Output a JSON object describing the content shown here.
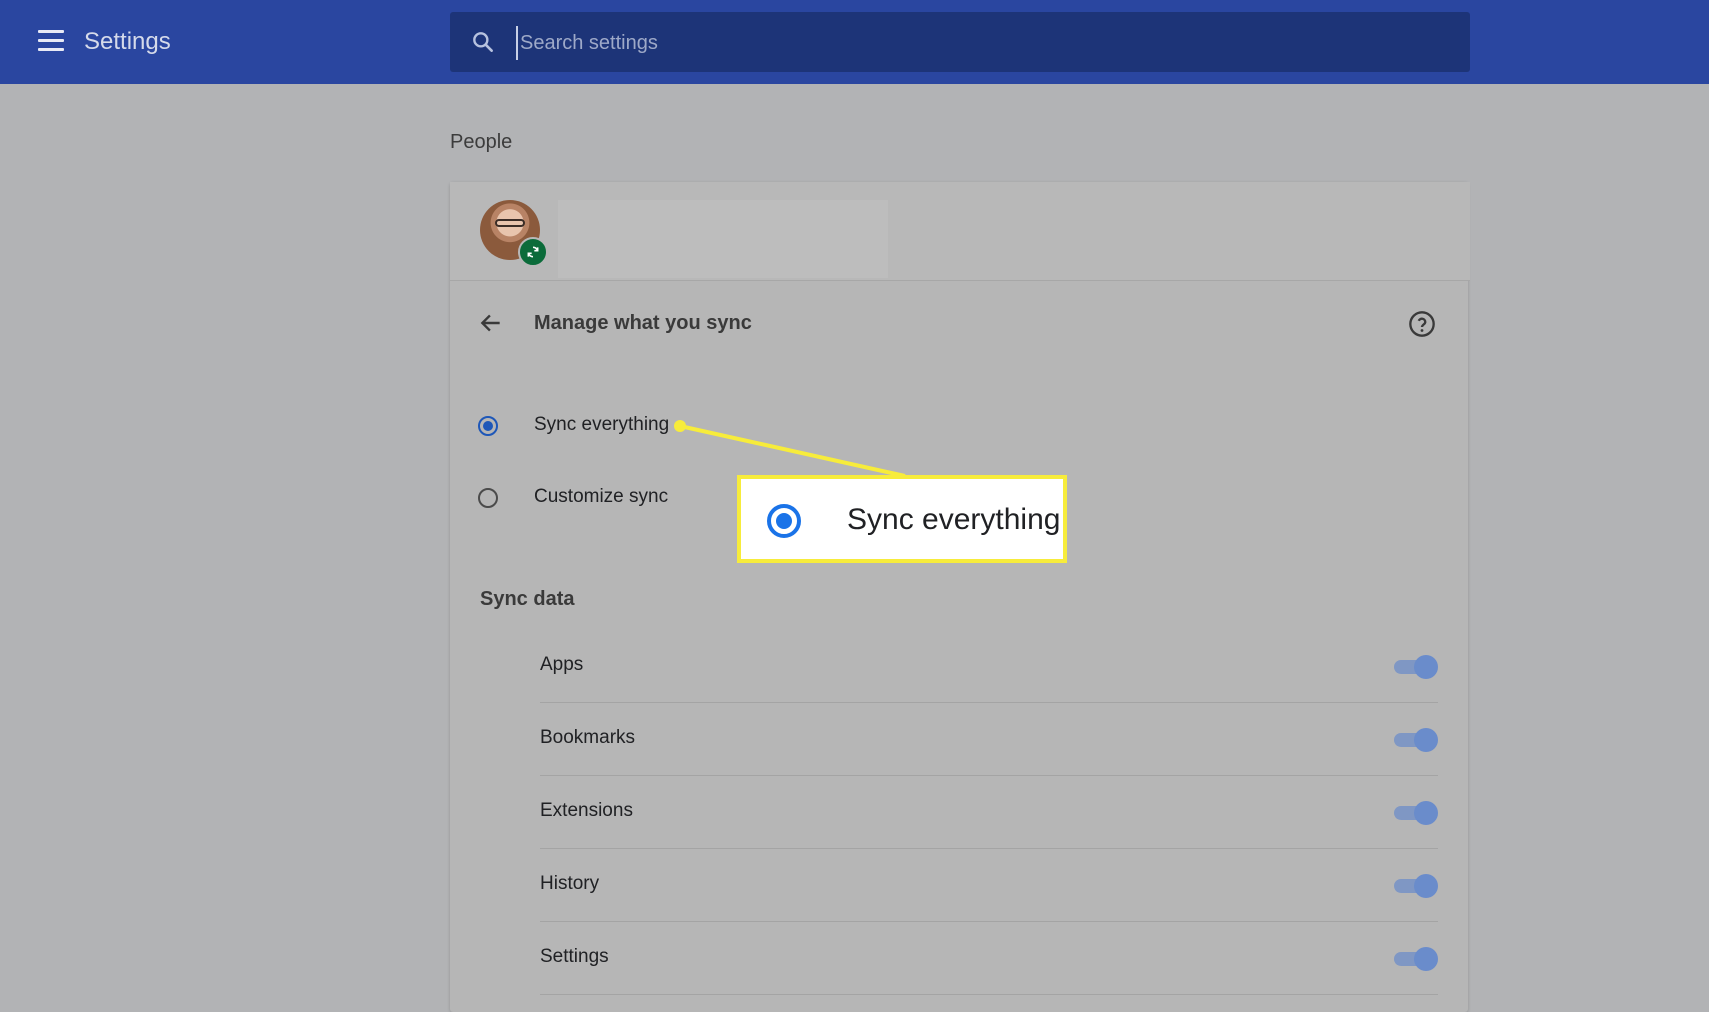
{
  "header": {
    "app_title": "Settings",
    "search_placeholder": "Search settings",
    "search_value": ""
  },
  "people": {
    "section_title": "People"
  },
  "sync": {
    "title": "Manage what you sync",
    "options": [
      {
        "label": "Sync everything",
        "checked": true
      },
      {
        "label": "Customize sync",
        "checked": false
      }
    ],
    "data_heading": "Sync data",
    "items": [
      {
        "label": "Apps",
        "on": true
      },
      {
        "label": "Bookmarks",
        "on": true
      },
      {
        "label": "Extensions",
        "on": true
      },
      {
        "label": "History",
        "on": true
      },
      {
        "label": "Settings",
        "on": true
      }
    ]
  },
  "callout": {
    "label": "Sync everything"
  },
  "colors": {
    "topbar": "#2a46a0",
    "search_bg": "#1d3478",
    "accent": "#1a73e8",
    "callout_border": "#f7ec3b",
    "sync_badge": "#0b6b3a"
  },
  "icons": [
    "menu-icon",
    "search-icon",
    "sync-icon",
    "back-arrow-icon",
    "help-icon"
  ]
}
